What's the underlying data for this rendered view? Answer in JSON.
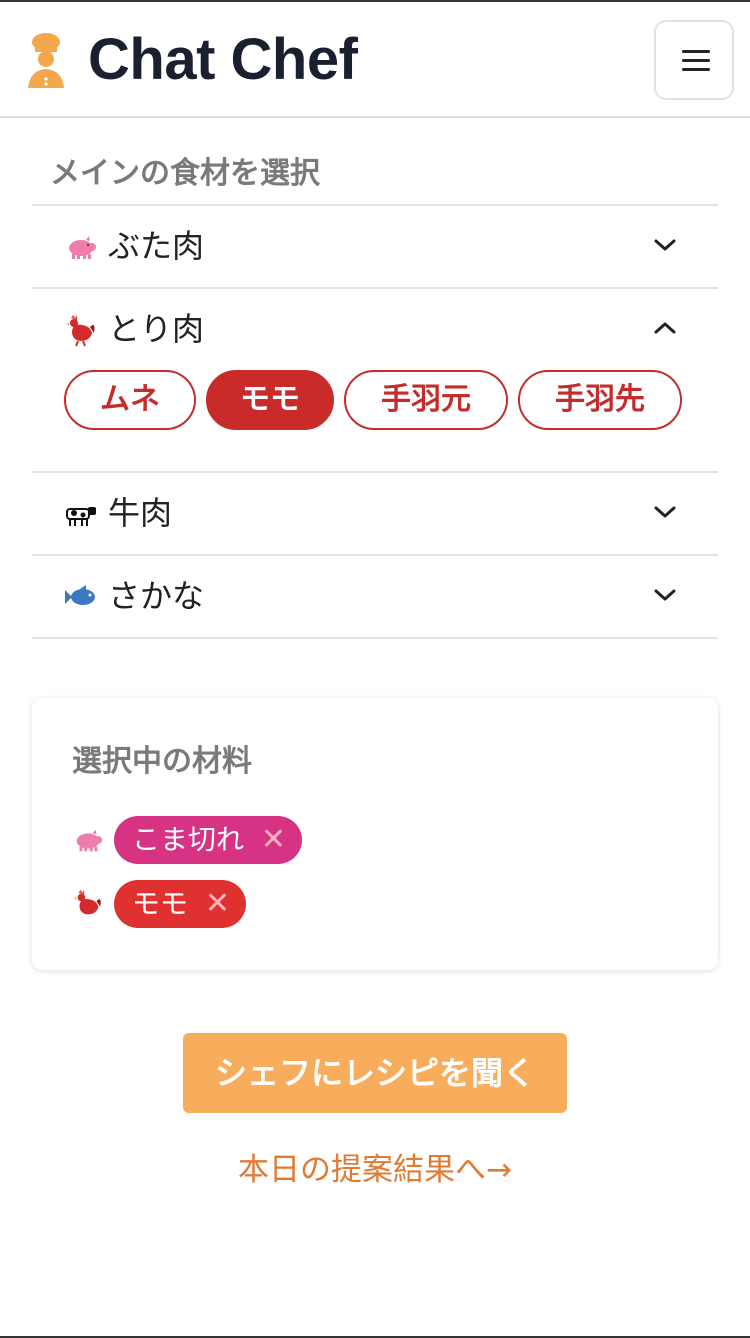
{
  "header": {
    "app_title": "Chat Chef",
    "logo_icon": "chef-icon",
    "menu_icon": "hamburger-menu-icon"
  },
  "ingredients": {
    "section_title": "メインの食材を選択",
    "categories": [
      {
        "label": "ぶた肉",
        "icon": "pig-icon",
        "expanded": false
      },
      {
        "label": "とり肉",
        "icon": "rooster-icon",
        "expanded": true,
        "options": [
          {
            "label": "ムネ",
            "selected": false
          },
          {
            "label": "モモ",
            "selected": true
          },
          {
            "label": "手羽元",
            "selected": false
          },
          {
            "label": "手羽先",
            "selected": false
          }
        ]
      },
      {
        "label": "牛肉",
        "icon": "cow-icon",
        "expanded": false
      },
      {
        "label": "さかな",
        "icon": "fish-icon",
        "expanded": false
      }
    ]
  },
  "selected": {
    "title": "選択中の材料",
    "items": [
      {
        "label": "こま切れ",
        "icon": "pig-icon",
        "color": "#d63384"
      },
      {
        "label": "モモ",
        "icon": "rooster-icon",
        "color": "#e03131"
      }
    ],
    "remove_symbol": "✕"
  },
  "actions": {
    "ask_button": "シェフにレシピを聞く",
    "result_link": "本日の提案結果へ→"
  },
  "colors": {
    "brand_orange": "#f8ad5c",
    "link_orange": "#e17b34",
    "chip_red": "#c92a2a"
  }
}
